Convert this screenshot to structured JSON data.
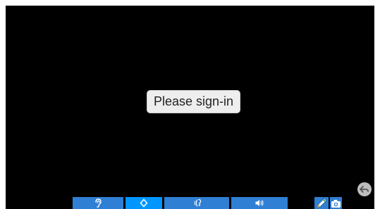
{
  "screen": {
    "message": "Please sign-in",
    "background_color": "#000000"
  },
  "toolbar": {
    "color": "#2f7fd4",
    "active_color": "#0096ff",
    "buttons": [
      {
        "icon": "ear-icon",
        "active": false
      },
      {
        "icon": "diamond-icon",
        "active": true
      },
      {
        "icon": "talk-icon",
        "active": false
      },
      {
        "icon": "volume-icon",
        "active": false
      }
    ],
    "extra_buttons": [
      {
        "icon": "pen-icon"
      },
      {
        "icon": "camera-icon"
      }
    ]
  },
  "back_button": {
    "icon": "back-arrow-icon"
  }
}
